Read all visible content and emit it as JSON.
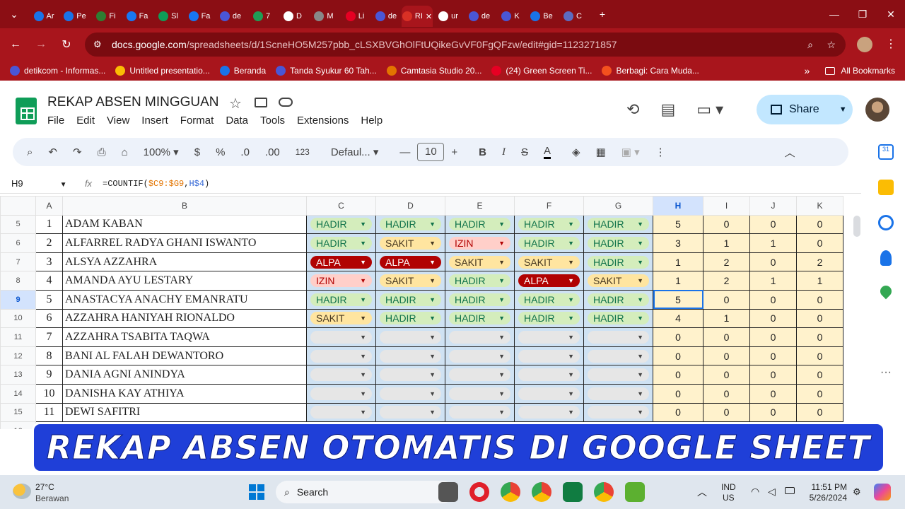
{
  "browser": {
    "tabs": [
      "Ar",
      "Pe",
      "Fi",
      "Fa",
      "Sl",
      "Fa",
      "de",
      "7",
      "D",
      "M",
      "Li",
      "de",
      "RI",
      "ur",
      "de",
      "K",
      "Be",
      "C"
    ],
    "url_host": "docs.google.com",
    "url_path": "/spreadsheets/d/1ScneHO5M257pbb_cLSXBVGhOlFtUQikeGvVF0FgQFzw/edit#gid=1123271857",
    "bookmarks": [
      "detikcom - Informas...",
      "Untitled presentatio...",
      "Beranda",
      "Tanda Syukur 60 Tah...",
      "Camtasia Studio 20...",
      "(24) Green Screen Ti...",
      "Berbagi: Cara Muda..."
    ],
    "all_bookmarks": "All Bookmarks",
    "more": "»"
  },
  "sheet": {
    "title": "REKAP ABSEN MINGGUAN",
    "menu": [
      "File",
      "Edit",
      "View",
      "Insert",
      "Format",
      "Data",
      "Tools",
      "Extensions",
      "Help"
    ],
    "share": "Share",
    "zoom": "100%",
    "currency": "$",
    "percent": "%",
    "dec_dec": ".0",
    "dec_inc": ".00",
    "format123": "123",
    "font": "Defaul...",
    "font_size": "10",
    "cell_ref": "H9",
    "formula": {
      "a": "=COUNTIF(",
      "b": "$C9:$G9",
      "c": ",",
      "d": "H$4",
      "e": ")"
    },
    "col_headers": [
      "A",
      "B",
      "C",
      "D",
      "E",
      "F",
      "G",
      "H",
      "I",
      "J",
      "K"
    ],
    "rows": [
      {
        "rn": "5",
        "no": "1",
        "name": "ADAM KABAN",
        "st": [
          "HADIR",
          "HADIR",
          "HADIR",
          "HADIR",
          "HADIR"
        ],
        "n": [
          "5",
          "0",
          "0",
          "0"
        ]
      },
      {
        "rn": "6",
        "no": "2",
        "name": "ALFARREL RADYA GHANI ISWANTO",
        "st": [
          "HADIR",
          "SAKIT",
          "IZIN",
          "HADIR",
          "HADIR"
        ],
        "n": [
          "3",
          "1",
          "1",
          "0"
        ]
      },
      {
        "rn": "7",
        "no": "3",
        "name": "ALSYA AZZAHRA",
        "st": [
          "ALPA",
          "ALPA",
          "SAKIT",
          "SAKIT",
          "HADIR"
        ],
        "n": [
          "1",
          "2",
          "0",
          "2"
        ]
      },
      {
        "rn": "8",
        "no": "4",
        "name": "AMANDA AYU LESTARY",
        "st": [
          "IZIN",
          "SAKIT",
          "HADIR",
          "ALPA",
          "SAKIT"
        ],
        "n": [
          "1",
          "2",
          "1",
          "1"
        ]
      },
      {
        "rn": "9",
        "no": "5",
        "name": "ANASTACYA ANACHY EMANRATU",
        "st": [
          "HADIR",
          "HADIR",
          "HADIR",
          "HADIR",
          "HADIR"
        ],
        "n": [
          "5",
          "0",
          "0",
          "0"
        ]
      },
      {
        "rn": "10",
        "no": "6",
        "name": "AZZAHRA HANIYAH RIONALDO",
        "st": [
          "SAKIT",
          "HADIR",
          "HADIR",
          "HADIR",
          "HADIR"
        ],
        "n": [
          "4",
          "1",
          "0",
          "0"
        ]
      },
      {
        "rn": "11",
        "no": "7",
        "name": "AZZAHRA TSABITA TAQWA",
        "st": [
          "",
          "",
          "",
          "",
          ""
        ],
        "n": [
          "0",
          "0",
          "0",
          "0"
        ]
      },
      {
        "rn": "12",
        "no": "8",
        "name": "BANI AL FALAH DEWANTORO",
        "st": [
          "",
          "",
          "",
          "",
          ""
        ],
        "n": [
          "0",
          "0",
          "0",
          "0"
        ]
      },
      {
        "rn": "13",
        "no": "9",
        "name": "DANIA AGNI ANINDYA",
        "st": [
          "",
          "",
          "",
          "",
          ""
        ],
        "n": [
          "0",
          "0",
          "0",
          "0"
        ]
      },
      {
        "rn": "14",
        "no": "10",
        "name": "DANISHA KAY ATHIYA",
        "st": [
          "",
          "",
          "",
          "",
          ""
        ],
        "n": [
          "0",
          "0",
          "0",
          "0"
        ]
      },
      {
        "rn": "15",
        "no": "11",
        "name": "DEWI SAFITRI",
        "st": [
          "",
          "",
          "",
          "",
          ""
        ],
        "n": [
          "0",
          "0",
          "0",
          "0"
        ]
      }
    ],
    "last_row": "16"
  },
  "banner": "REKAP ABSEN OTOMATIS DI GOOGLE SHEET",
  "taskbar": {
    "temp": "27°C",
    "weather": "Berawan",
    "search": "Search",
    "lang1": "IND",
    "lang2": "US",
    "time": "11:51 PM",
    "date": "5/26/2024"
  },
  "colors": {
    "hadir": "#d4edbc",
    "sakit": "#ffe5a0",
    "izin": "#ffcfc9",
    "alpa": "#b10202",
    "status_bg": "#cfe2f3",
    "count_bg": "#fff2cc",
    "chrome": "#a8151c"
  }
}
